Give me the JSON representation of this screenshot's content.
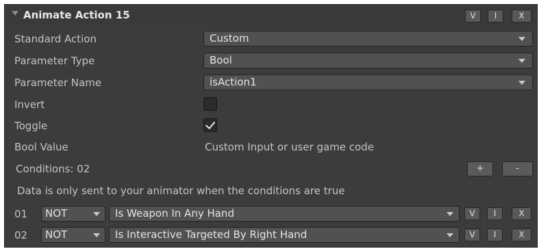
{
  "header": {
    "title": "Animate Action 15",
    "buttons": [
      "V",
      "I",
      "X"
    ]
  },
  "fields": {
    "standard_action": {
      "label": "Standard Action",
      "value": "Custom"
    },
    "parameter_type": {
      "label": "Parameter Type",
      "value": "Bool"
    },
    "parameter_name": {
      "label": "Parameter Name",
      "value": "isAction1"
    },
    "invert": {
      "label": "Invert",
      "checked": false
    },
    "toggle": {
      "label": "Toggle",
      "checked": true
    },
    "bool_value": {
      "label": "Bool Value",
      "value": "Custom Input or user game code"
    }
  },
  "conditions": {
    "label": "Conditions: 02",
    "add_label": "+",
    "remove_label": "-",
    "info": "Data is only sent to your animator when the conditions are true",
    "items": [
      {
        "index": "01",
        "operator": "NOT",
        "condition": "Is Weapon In Any Hand",
        "buttons": [
          "V",
          "I",
          "X"
        ]
      },
      {
        "index": "02",
        "operator": "NOT",
        "condition": "Is Interactive Targeted By Right Hand",
        "buttons": [
          "V",
          "I",
          "X"
        ]
      }
    ]
  },
  "colors": {
    "panel_bg": "#3c3c3c",
    "field_bg": "#515151",
    "text": "#c4c4c4"
  }
}
